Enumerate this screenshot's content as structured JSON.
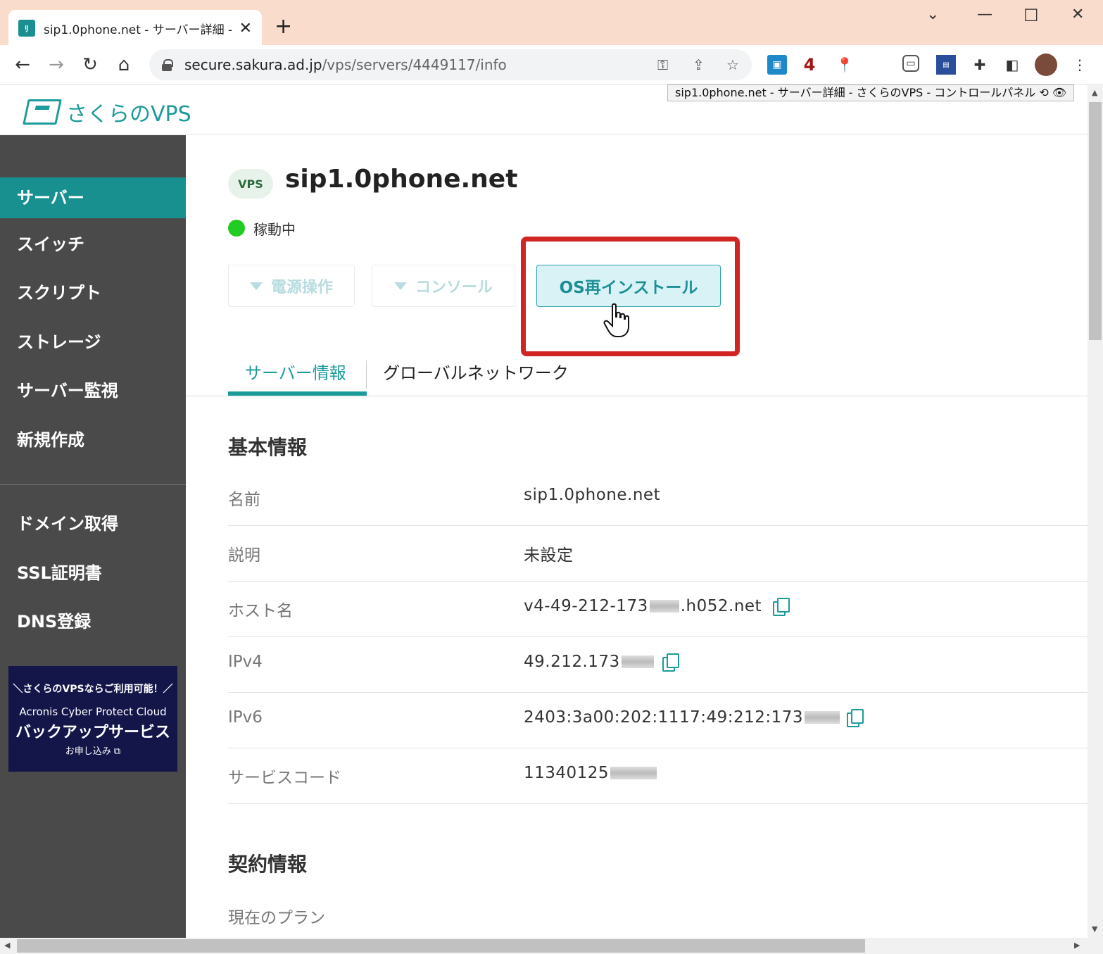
{
  "browser": {
    "tab_title": "sip1.0phone.net - サーバー詳細 - さ",
    "url_host": "secure.sakura.ad.jp",
    "url_path": "/vps/servers/4449117/info",
    "tooltip": "sip1.0phone.net - サーバー詳細 - さくらのVPS - コントロールパネル",
    "ext_badge": "4"
  },
  "header": {
    "logo_text": "さくらのVPS"
  },
  "sidebar": {
    "items": [
      {
        "label": "サーバー"
      },
      {
        "label": "スイッチ"
      },
      {
        "label": "スクリプト"
      },
      {
        "label": "ストレージ"
      },
      {
        "label": "サーバー監視"
      },
      {
        "label": "新規作成"
      },
      {
        "label": "ドメイン取得"
      },
      {
        "label": "SSL証明書"
      },
      {
        "label": "DNS登録"
      }
    ],
    "banner": {
      "line1": "＼さくらのVPSならご利用可能！／",
      "line2": "Acronis Cyber Protect Cloud",
      "line3": "バックアップサービス",
      "line4": "お申し込み"
    }
  },
  "server": {
    "badge": "VPS",
    "name": "sip1.0phone.net",
    "status": "稼動中"
  },
  "actions": {
    "power": "電源操作",
    "console": "コンソール",
    "reinstall": "OS再インストール"
  },
  "tabs": {
    "server_info": "サーバー情報",
    "global_network": "グローバルネットワーク"
  },
  "basic_info": {
    "title": "基本情報",
    "rows": [
      {
        "label": "名前",
        "value": "sip1.0phone.net"
      },
      {
        "label": "説明",
        "value": "未設定"
      },
      {
        "label": "ホスト名",
        "value": "v4-49-212-173",
        "suffix": ".h052.net"
      },
      {
        "label": "IPv4",
        "value": "49.212.173"
      },
      {
        "label": "IPv6",
        "value": "2403:3a00:202:1117:49:212:173"
      },
      {
        "label": "サービスコード",
        "value": "11340125"
      }
    ]
  },
  "contract_info": {
    "title": "契約情報",
    "plan_label": "現在のプラン"
  },
  "colors": {
    "brand": "#1c9b9b",
    "sidebar_bg": "#4a4a4a",
    "sidebar_active": "#17908f",
    "status_running": "#22cc22",
    "highlight": "#d32424"
  }
}
